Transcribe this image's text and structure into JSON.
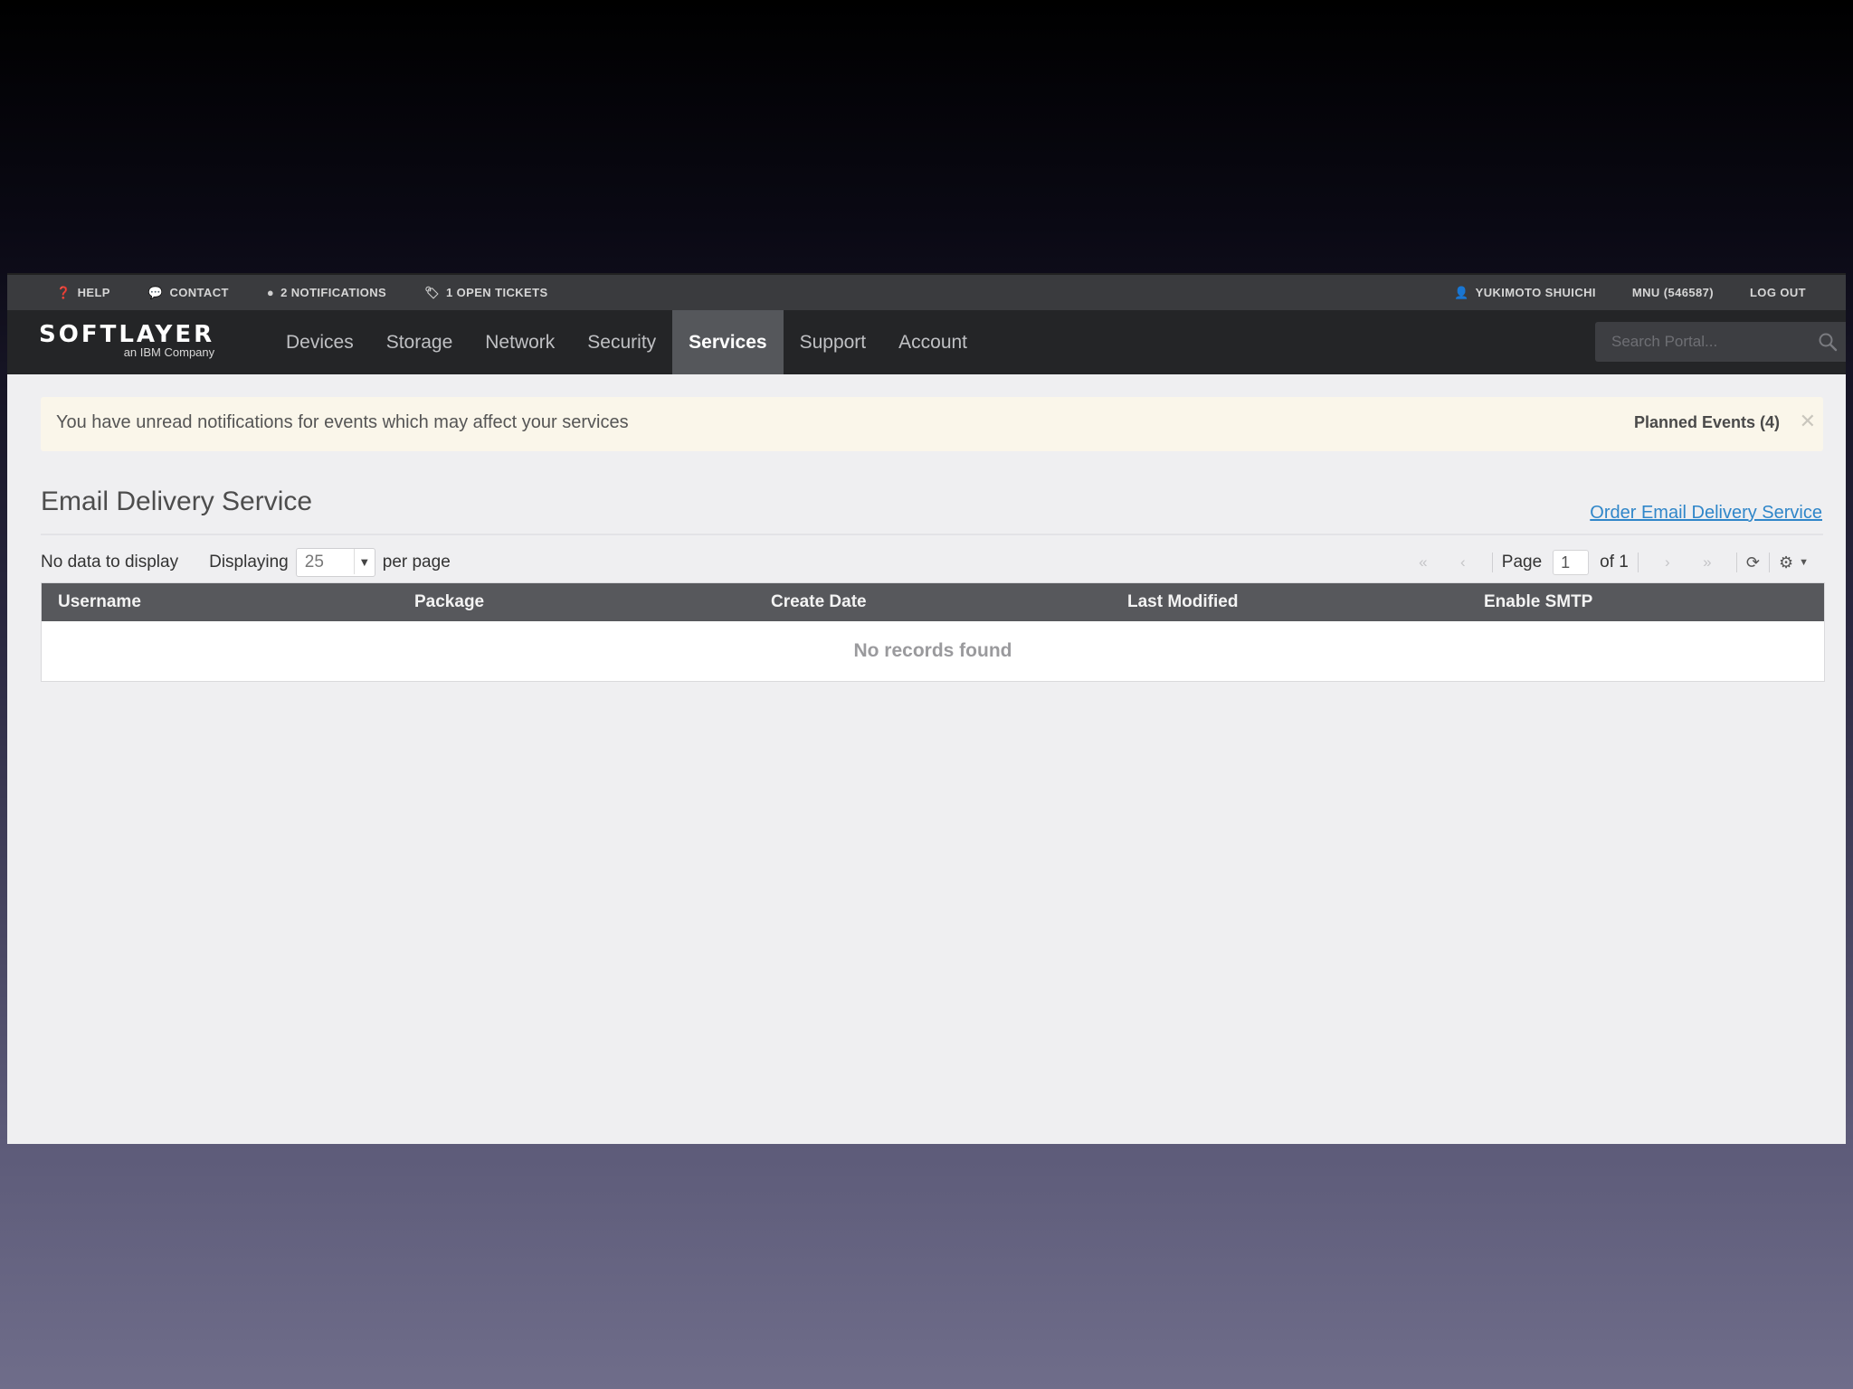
{
  "util_bar": {
    "left": [
      {
        "icon": "help-icon",
        "label": "HELP"
      },
      {
        "icon": "contact-icon",
        "label": "CONTACT"
      },
      {
        "icon": "notification-icon",
        "label": "2 NOTIFICATIONS"
      },
      {
        "icon": "ticket-icon",
        "label": "1 OPEN TICKETS"
      }
    ],
    "user": "YUKIMOTO SHUICHI",
    "account": "MNU (546587)",
    "logout": "LOG OUT"
  },
  "nav": {
    "logo": "SOFTLAYER",
    "logo_sub": "an IBM Company",
    "tabs": [
      "Devices",
      "Storage",
      "Network",
      "Security",
      "Services",
      "Support",
      "Account"
    ],
    "active_tab": "Services",
    "search_placeholder": "Search Portal..."
  },
  "alert": {
    "message": "You have unread notifications for events which may affect your services",
    "link": "Planned Events (4)",
    "close": "✕"
  },
  "page": {
    "title": "Email Delivery Service",
    "order_link": "Order Email Delivery Service"
  },
  "toolbar": {
    "no_data": "No data to display",
    "displaying": "Displaying",
    "per_page_value": "25",
    "per_page": "per page",
    "page_label": "Page",
    "page_value": "1",
    "of_label": "of 1"
  },
  "table": {
    "columns": [
      "Username",
      "Package",
      "Create Date",
      "Last Modified",
      "Enable SMTP"
    ],
    "empty": "No records found"
  },
  "colors": {
    "nav_bg": "#242527",
    "active_tab_bg": "#55575b",
    "alert_bg": "#faf6ea",
    "link": "#2f86c9",
    "table_header_bg": "#57585c"
  }
}
